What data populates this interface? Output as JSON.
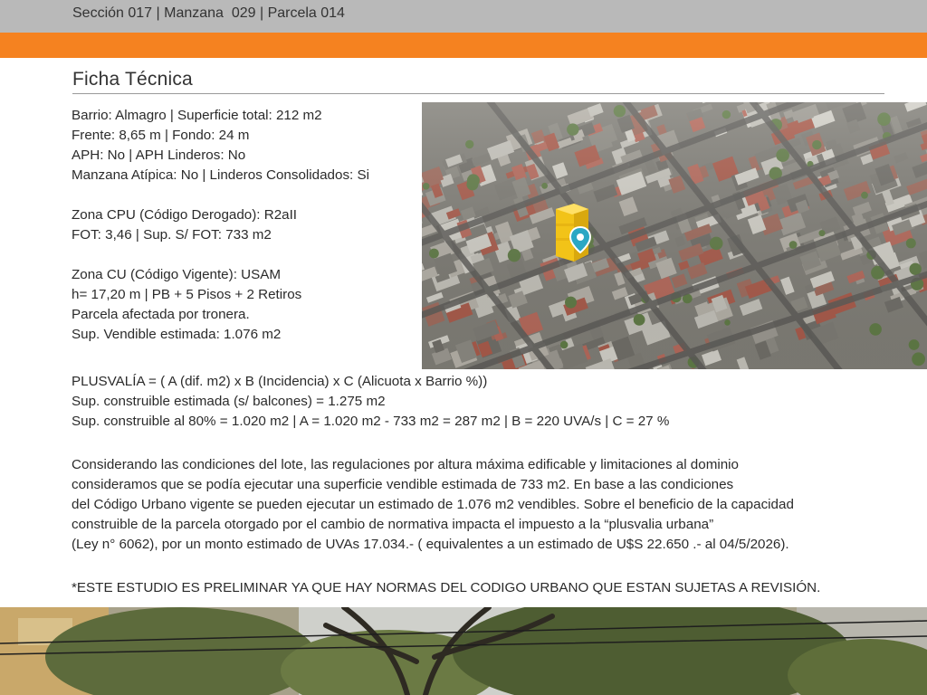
{
  "header": {
    "reference": "Sección 017 | Manzana  029 | Parcela 014"
  },
  "ficha": {
    "title": "Ficha Técnica",
    "lines": [
      "Barrio: Almagro | Superficie total:  212 m2",
      "Frente: 8,65 m | Fondo: 24 m",
      "APH: No  | APH Linderos: No",
      "Manzana Atípica: No  | Linderos Consolidados: Si",
      "",
      "Zona CPU (Código Derogado): R2aII",
      "FOT: 3,46 | Sup. S/ FOT: 733 m2",
      "",
      "Zona CU (Código Vigente): USAM",
      "h= 17,20 m | PB + 5 Pisos + 2 Retiros",
      "Parcela afectada por tronera.",
      "Sup. Vendible estimada:  1.076 m2"
    ]
  },
  "plusvalia": {
    "lines": [
      "PLUSVALÍA = ( A (dif. m2) x B (Incidencia) x C (Alicuota x Barrio %))",
      "Sup. construible estimada (s/ balcones) = 1.275 m2",
      "Sup. construible al 80% = 1.020 m2 |  A = 1.020 m2 - 733 m2 = 287 m2 | B = 220 UVA/s | C = 27 %"
    ]
  },
  "paragraph": {
    "lines": [
      "Considerando las condiciones del lote, las regulaciones por altura máxima edificable y limitaciones al  dominio",
      "consideramos que se podía ejecutar una superficie vendible estimada de 733 m2.  En base a las condiciones",
      "del Código Urbano vigente se pueden ejecutar un estimado de 1.076 m2 vendibles. Sobre el beneficio de la capacidad",
      "construible de la parcela otorgado por el cambio de normativa impacta el impuesto a la “plusvalia urbana”",
      "(Ley n° 6062), por un monto estimado de UVAs 17.034.- ( equivalentes a un estimado de U$S 22.650 .- al 04/5/2026)."
    ]
  },
  "disclaimer": "*ESTE ESTUDIO ES PRELIMINAR YA QUE HAY NORMAS DEL CODIGO URBANO QUE ESTAN SUJETAS A REVISIÓN.",
  "colors": {
    "header_gray": "#b9b9b9",
    "accent_orange": "#f58220",
    "building_yellow": "#f2c318",
    "pin_teal": "#2aa7c4"
  },
  "icons": {
    "map_pin": "map-pin-icon"
  }
}
